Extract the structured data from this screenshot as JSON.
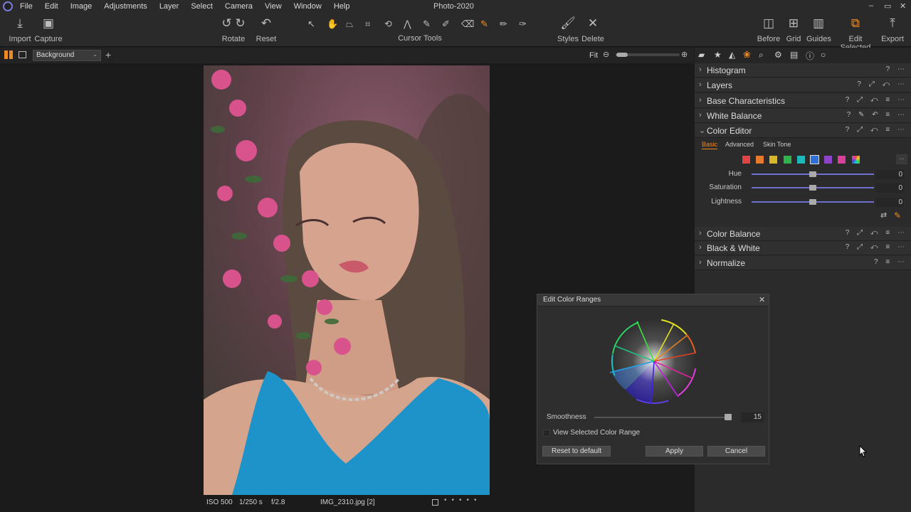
{
  "app": {
    "title": "Photo-2020"
  },
  "menu": [
    "File",
    "Edit",
    "Image",
    "Adjustments",
    "Layer",
    "Select",
    "Camera",
    "View",
    "Window",
    "Help"
  ],
  "window_controls": {
    "minimize": "–",
    "maximize": "▭",
    "close": "✕"
  },
  "toolbar": {
    "import": "Import",
    "capture": "Capture",
    "rotate": "Rotate",
    "reset": "Reset",
    "cursor_tools": "Cursor Tools",
    "styles": "Styles",
    "delete": "Delete",
    "before": "Before",
    "grid": "Grid",
    "guides": "Guides",
    "edit_selected": "Edit Selected",
    "export": "Export"
  },
  "viewer": {
    "layer_select": "Background",
    "zoom_label": "Fit"
  },
  "status": {
    "iso": "ISO 500",
    "shutter": "1/250 s",
    "aperture": "f/2.8",
    "filename": "IMG_2310.jpg [2]"
  },
  "inspector": {
    "sections_top": [
      "Histogram",
      "Layers",
      "Base Characteristics",
      "White Balance"
    ],
    "color_editor": {
      "title": "Color Editor",
      "tabs": [
        "Basic",
        "Advanced",
        "Skin Tone"
      ],
      "active_tab": "Basic",
      "swatches": [
        "#e04545",
        "#e87a2e",
        "#d7b628",
        "#2fb34b",
        "#1fb8b8",
        "#2f6fd8",
        "#8e44c8",
        "#d8409a"
      ],
      "selected_swatch": 5,
      "more_button": "...",
      "sliders": [
        {
          "label": "Hue",
          "value": "0",
          "level": 0.5
        },
        {
          "label": "Saturation",
          "value": "0",
          "level": 0.5
        },
        {
          "label": "Lightness",
          "value": "0",
          "level": 0.5
        }
      ]
    },
    "sections_bottom": [
      "Color Balance",
      "Black & White",
      "Normalize"
    ]
  },
  "dialog": {
    "title": "Edit Color Ranges",
    "close": "✕",
    "smoothness_label": "Smoothness",
    "smoothness_value": "15",
    "smoothness_level": 0.98,
    "view_selected": "View Selected Color Range",
    "reset": "Reset to default",
    "apply": "Apply",
    "cancel": "Cancel"
  }
}
